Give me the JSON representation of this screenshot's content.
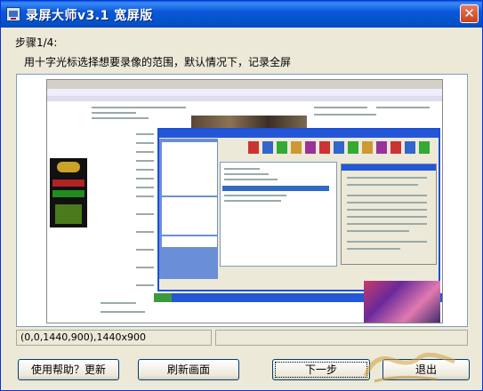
{
  "window": {
    "title": "录屏大师v3.1 宽屏版",
    "close_glyph": "✕"
  },
  "step": {
    "label": "步骤1/4:",
    "instruction": "用十字光标选择想要录像的范围，默认情况下，记录全屏"
  },
  "status": {
    "coords": "(0,0,1440,900),1440x900"
  },
  "buttons": {
    "help": "使用帮助？更新",
    "refresh": "刷新画面",
    "next": "下一步",
    "exit": "退出"
  },
  "icons": {
    "app": "screen-recorder-icon",
    "close": "close-icon"
  },
  "colors": {
    "titlebar": "#0350c8",
    "window_bg": "#ece9d8"
  }
}
